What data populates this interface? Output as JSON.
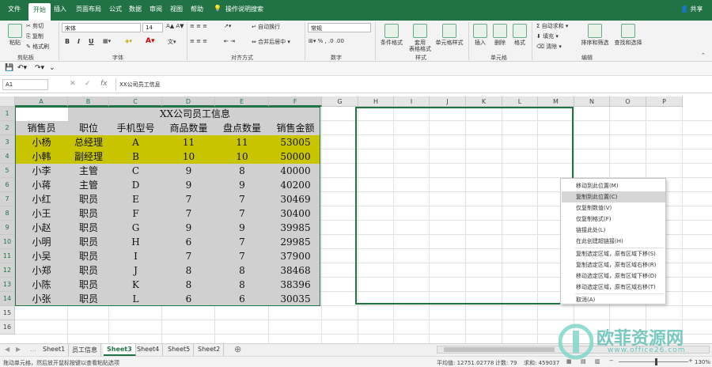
{
  "menu": {
    "items": [
      "文件",
      "开始",
      "插入",
      "页面布局",
      "公式",
      "数据",
      "审阅",
      "视图",
      "帮助"
    ],
    "search": "操作说明搜索",
    "share": "共享"
  },
  "ribbon": {
    "clipboard": {
      "paste": "粘贴",
      "cut": "剪切",
      "copy": "复制",
      "painter": "格式刷",
      "group": "剪贴板"
    },
    "font": {
      "name": "宋体",
      "size": "14",
      "group": "字体",
      "bold": "B",
      "italic": "I",
      "underline": "U"
    },
    "align": {
      "wrap": "自动换行",
      "merge": "合并后居中",
      "group": "对齐方式"
    },
    "number": {
      "format": "常规",
      "group": "数字"
    },
    "styles": {
      "cond": "条件格式",
      "table": "套用\n表格格式",
      "cell": "单元格样式",
      "group": "样式"
    },
    "cells": {
      "insert": "插入",
      "delete": "删除",
      "format": "格式",
      "group": "单元格"
    },
    "edit": {
      "autosum": "自动求和",
      "fill": "填充",
      "clear": "清除",
      "sort": "排序和筛选",
      "find": "查找和选择",
      "group": "编辑"
    }
  },
  "formula": {
    "namebox": "A1",
    "fx": "fx",
    "content": "XX公司员工信息"
  },
  "columns": [
    "A",
    "B",
    "C",
    "D",
    "E",
    "F",
    "G",
    "H",
    "I",
    "J",
    "K",
    "L",
    "M",
    "N",
    "O",
    "P"
  ],
  "rows": [
    "1",
    "2",
    "3",
    "4",
    "5",
    "6",
    "7",
    "8",
    "9",
    "10",
    "11",
    "12",
    "13",
    "14",
    "15",
    "16"
  ],
  "table": {
    "title": "XX公司员工信息",
    "headers": [
      "销售员",
      "职位",
      "手机型号",
      "商品数量",
      "盘点数量",
      "销售金额"
    ],
    "data": [
      [
        "小杨",
        "总经理",
        "A",
        "11",
        "11",
        "53005"
      ],
      [
        "小韩",
        "副经理",
        "B",
        "10",
        "10",
        "50000"
      ],
      [
        "小李",
        "主管",
        "C",
        "9",
        "8",
        "40000"
      ],
      [
        "小蒋",
        "主管",
        "D",
        "9",
        "9",
        "40200"
      ],
      [
        "小红",
        "职员",
        "E",
        "7",
        "7",
        "30469"
      ],
      [
        "小王",
        "职员",
        "F",
        "7",
        "7",
        "30400"
      ],
      [
        "小赵",
        "职员",
        "G",
        "9",
        "9",
        "39985"
      ],
      [
        "小明",
        "职员",
        "H",
        "6",
        "7",
        "29985"
      ],
      [
        "小吴",
        "职员",
        "I",
        "7",
        "7",
        "37900"
      ],
      [
        "小郑",
        "职员",
        "J",
        "8",
        "8",
        "38468"
      ],
      [
        "小陈",
        "职员",
        "K",
        "8",
        "8",
        "38396"
      ],
      [
        "小张",
        "职员",
        "L",
        "6",
        "6",
        "30035"
      ]
    ]
  },
  "context_menu": [
    "移动到此位置(M)",
    "复制到此位置(C)",
    "仅复制数值(V)",
    "仅复制格式(F)",
    "链接此处(L)",
    "在此创建超链接(H)",
    "复制选定区域，原有区域下移(S)",
    "复制选定区域，原有区域右移(R)",
    "移动选定区域，原有区域下移(D)",
    "移动选定区域，原有区域右移(T)",
    "取消(A)"
  ],
  "sheets": [
    "Sheet1",
    "员工信息",
    "Sheet3",
    "Sheet4",
    "Sheet5",
    "Sheet2"
  ],
  "active_sheet": "Sheet3",
  "status": {
    "left": "拖动单元格，然后放开鼠标按键以查看粘贴选项",
    "avg": "平均值: 12751.02778",
    "count": "计数: 79",
    "sum": "求和: 459037",
    "zoom": "130%"
  },
  "watermark": {
    "title": "欧菲资源网",
    "url": "www.office26.com"
  },
  "colors": {
    "accent": "#217346",
    "highlight": "#c9c400",
    "table_bg": "#d0d0d0"
  }
}
